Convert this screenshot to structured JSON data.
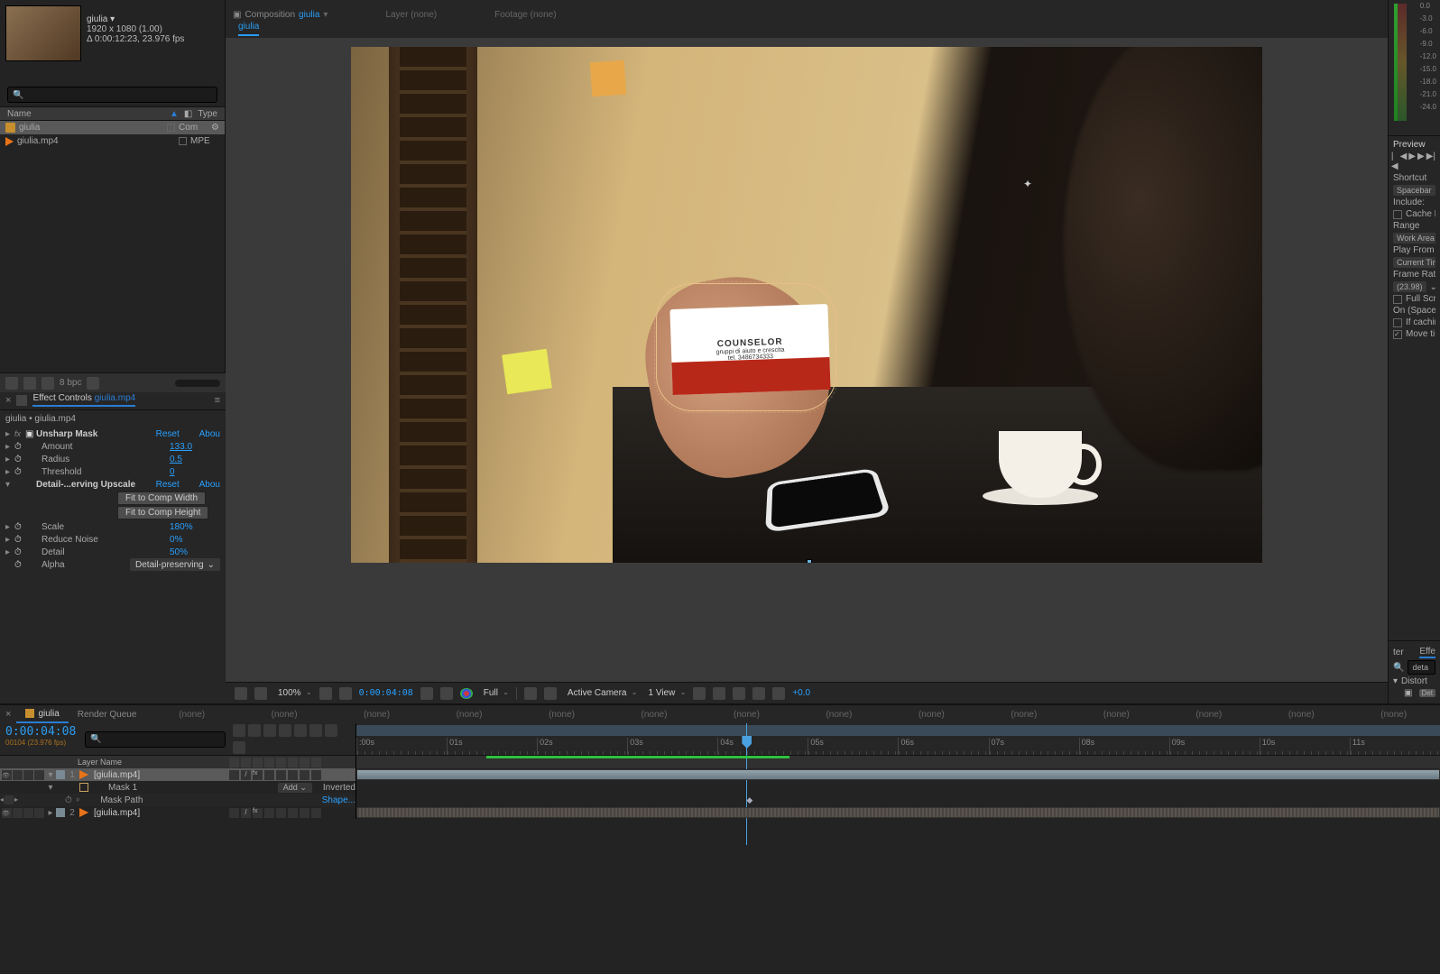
{
  "project": {
    "comp_name": "giulia",
    "dimensions": "1920 x 1080 (1.00)",
    "duration": "Δ 0:00:12:23, 23.976 fps",
    "columns": {
      "name": "Name",
      "type": "Type"
    },
    "items": [
      {
        "name": "giulia",
        "type": "Com",
        "icon": "comp",
        "selected": true
      },
      {
        "name": "giulia.mp4",
        "type": "MPE",
        "icon": "mov",
        "selected": false
      }
    ],
    "bpc": "8 bpc"
  },
  "effects": {
    "tab": "Effect Controls",
    "target": "giulia.mp4",
    "breadcrumb": "giulia • giulia.mp4",
    "unsharp": {
      "name": "Unsharp Mask",
      "reset": "Reset",
      "about": "Abou",
      "amount_label": "Amount",
      "amount_val": "133.0",
      "radius_label": "Radius",
      "radius_val": "0.5",
      "threshold_label": "Threshold",
      "threshold_val": "0"
    },
    "upscale": {
      "name": "Detail-...erving Upscale",
      "reset": "Reset",
      "about": "Abou",
      "btn_fit_w": "Fit to Comp Width",
      "btn_fit_h": "Fit to Comp Height",
      "scale_label": "Scale",
      "scale_val": "180",
      "scale_unit": "%",
      "noise_label": "Reduce Noise",
      "noise_val": "0",
      "noise_unit": "%",
      "detail_label": "Detail",
      "detail_val": "50",
      "detail_unit": "%",
      "alpha_label": "Alpha",
      "alpha_val": "Detail-preserving"
    }
  },
  "composition": {
    "label_prefix": "Composition",
    "name": "giulia",
    "tab": "giulia",
    "other_tabs": {
      "layer": "Layer (none)",
      "footage": "Footage (none)"
    },
    "card": {
      "line1": "COUNSELOR",
      "line2": "gruppi di aiuto e crescita",
      "line3": "tel. 3486734333"
    }
  },
  "viewer_bar": {
    "zoom": "100%",
    "timecode": "0:00:04:08",
    "resolution": "Full",
    "camera": "Active Camera",
    "views": "1 View",
    "exposure": "+0.0"
  },
  "preview": {
    "title": "Preview",
    "shortcut_label": "Shortcut",
    "shortcut_val": "Spacebar",
    "include_label": "Include:",
    "cache_before": "Cache Be",
    "range_label": "Range",
    "range_val": "Work Area",
    "play_from_label": "Play From",
    "play_from_val": "Current Tim",
    "framerate_label": "Frame Rate",
    "framerate_val": "(23.98)",
    "full_screen": "Full Scree",
    "on_spacebar": "On (Spaceba",
    "if_caching": "If caching,",
    "move_time": "Move tim"
  },
  "audio_meter": {
    "labels": [
      "0.0",
      "-3.0",
      "-6.0",
      "-9.0",
      "-12.0",
      "-15.0",
      "-18.0",
      "-21.0",
      "-24.0"
    ]
  },
  "effects_browser": {
    "tab_active": "Effe",
    "tab_other": "ter",
    "search": "deta",
    "category": "Distort",
    "item": "Det"
  },
  "timeline": {
    "tab_active": "giulia",
    "tab_rq": "Render Queue",
    "none": "(none)",
    "timecode": "0:00:04:08",
    "sub_tc": "00104 (23.976 fps)",
    "col_layer": "Layer Name",
    "ruler": [
      ":00s",
      "01s",
      "02s",
      "03s",
      "04s",
      "05s",
      "06s",
      "07s",
      "08s",
      "09s",
      "10s",
      "11s"
    ],
    "layers": [
      {
        "num": "1",
        "name": "[giulia.mp4]",
        "icon": "mov",
        "sel": true,
        "bracket": true
      },
      {
        "sub": true,
        "name": "Mask 1",
        "mode": "Add",
        "inverted": "Inverted"
      },
      {
        "sub": true,
        "key": true,
        "name": "Mask Path",
        "link": "Shape..."
      },
      {
        "num": "2",
        "name": "[giulia.mp4]",
        "icon": "mov",
        "sel": false,
        "bracket": true
      }
    ]
  }
}
